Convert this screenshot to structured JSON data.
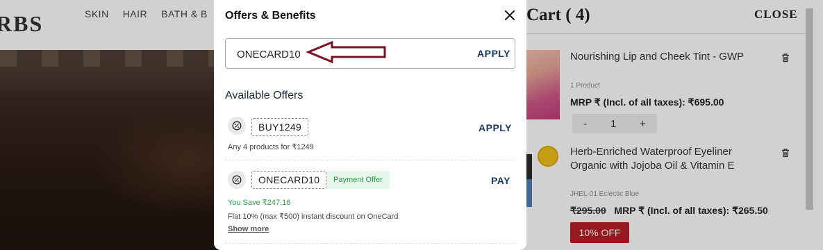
{
  "site": {
    "logo": "RBS",
    "nav": [
      "SKIN",
      "HAIR",
      "BATH & B"
    ]
  },
  "cart": {
    "title": "Cart ( 4)",
    "close_label": "CLOSE",
    "items": [
      {
        "name": "Nourishing Lip and Cheek Tint - GWP",
        "sub": "1 Product",
        "price": "MRP ₹ (Incl. of all taxes): ₹695.00",
        "qty": "1",
        "minus": "-",
        "plus": "+"
      },
      {
        "name": "Herb-Enriched Waterproof Eyeliner Organic with Jojoba Oil & Vitamin E",
        "sub": "JHEL-01 Eclectic Blue",
        "old_price": "₹295.00",
        "price": "MRP ₹ (Incl. of all taxes): ₹265.50",
        "discount": "10% OFF"
      }
    ]
  },
  "modal": {
    "title": "Offers & Benefits",
    "coupon_value": "ONECARD10",
    "apply_label": "APPLY",
    "section_title": "Available Offers",
    "offers": [
      {
        "code": "BUY1249",
        "action": "APPLY",
        "description": "Any 4 products for ₹1249"
      },
      {
        "code": "ONECARD10",
        "tag": "Payment Offer",
        "action": "PAY",
        "savings": "You Save ₹247.16",
        "description": "Flat 10% (max ₹500) instant discount on OneCard",
        "show_more": "Show more"
      }
    ]
  },
  "colors": {
    "accent_navy": "#1b3a63",
    "payment_green": "#2f9a4a",
    "discount_red": "#b81f27",
    "annotation_arrow": "#7a1020"
  },
  "icons": {
    "close": "close-icon",
    "trash": "trash-icon",
    "offer": "discount-badge-icon",
    "annotation": "arrow-annotation-icon"
  }
}
